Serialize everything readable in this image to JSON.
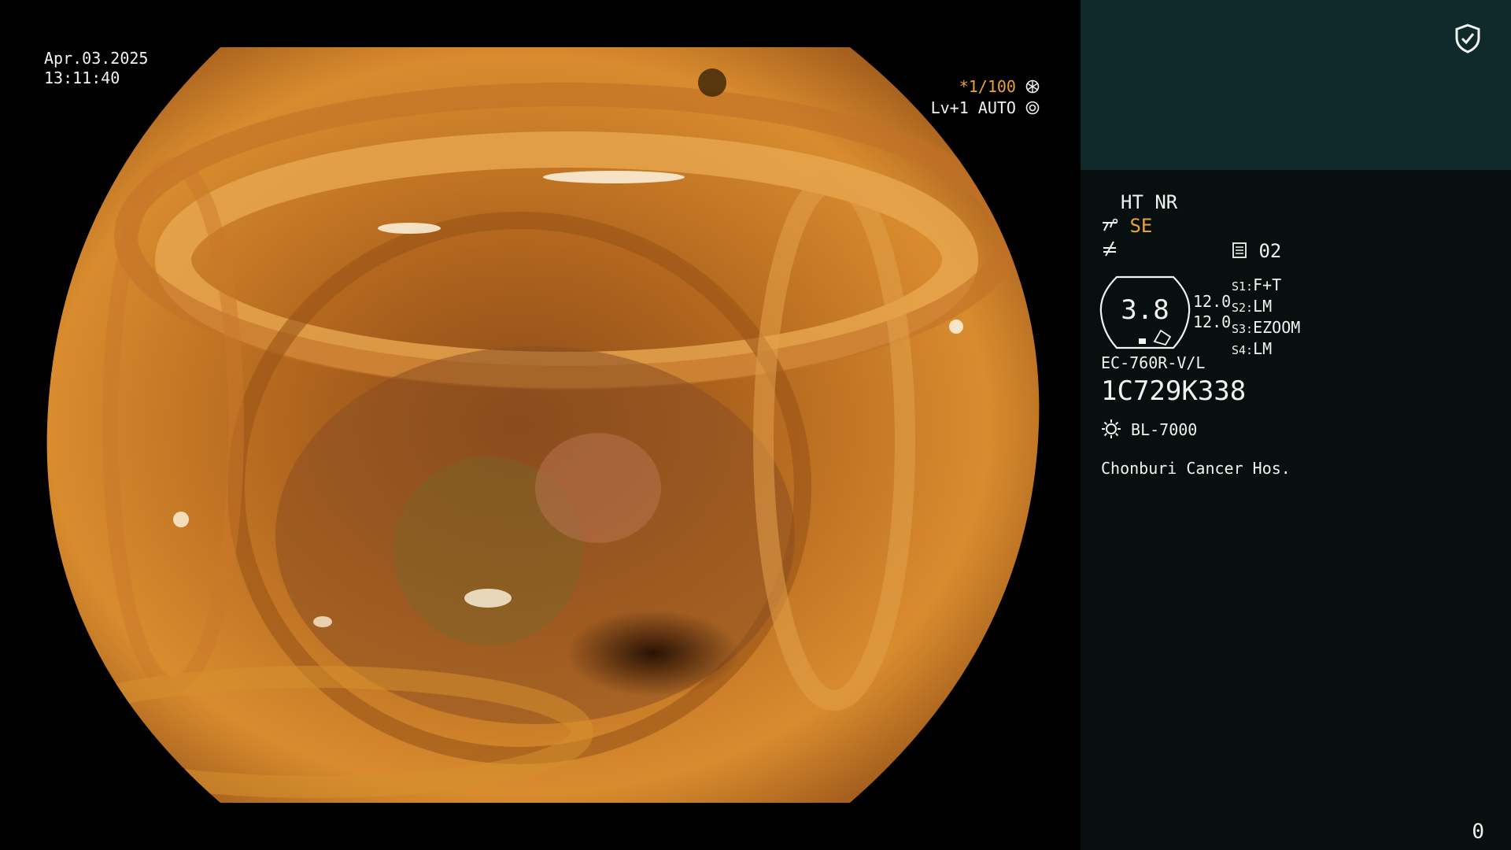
{
  "overlay": {
    "date": "Apr.03.2025",
    "time": "13:11:40",
    "shutter": "*1/100",
    "level": "Lv+1 AUTO"
  },
  "panel": {
    "modes": "HT NR",
    "se": "SE",
    "doc_number": "02",
    "zoom_value": "3.8",
    "values": [
      "12.0",
      "12.0"
    ],
    "switches": [
      {
        "key": "S1:",
        "value": "F+T"
      },
      {
        "key": "S2:",
        "value": "LM"
      },
      {
        "key": "S3:",
        "value": "EZOOM"
      },
      {
        "key": "S4:",
        "value": "LM"
      }
    ],
    "scope_model": "EC-760R-V/L",
    "scope_serial": "1C729K338",
    "light_source": "BL-7000",
    "hospital": "Chonburi Cancer Hos.",
    "counter": "0"
  },
  "icons": {
    "shield": "shield-check-icon",
    "shutter": "aperture-icon",
    "level": "iris-icon",
    "scissors": "scissors-icon",
    "slash": "slash-icon",
    "doc": "document-icon",
    "sun": "sun-icon"
  },
  "colors": {
    "accent": "#e8a33a",
    "panel_top": "#10292a",
    "panel_bottom": "#07100f",
    "text": "#f2f2f2"
  }
}
